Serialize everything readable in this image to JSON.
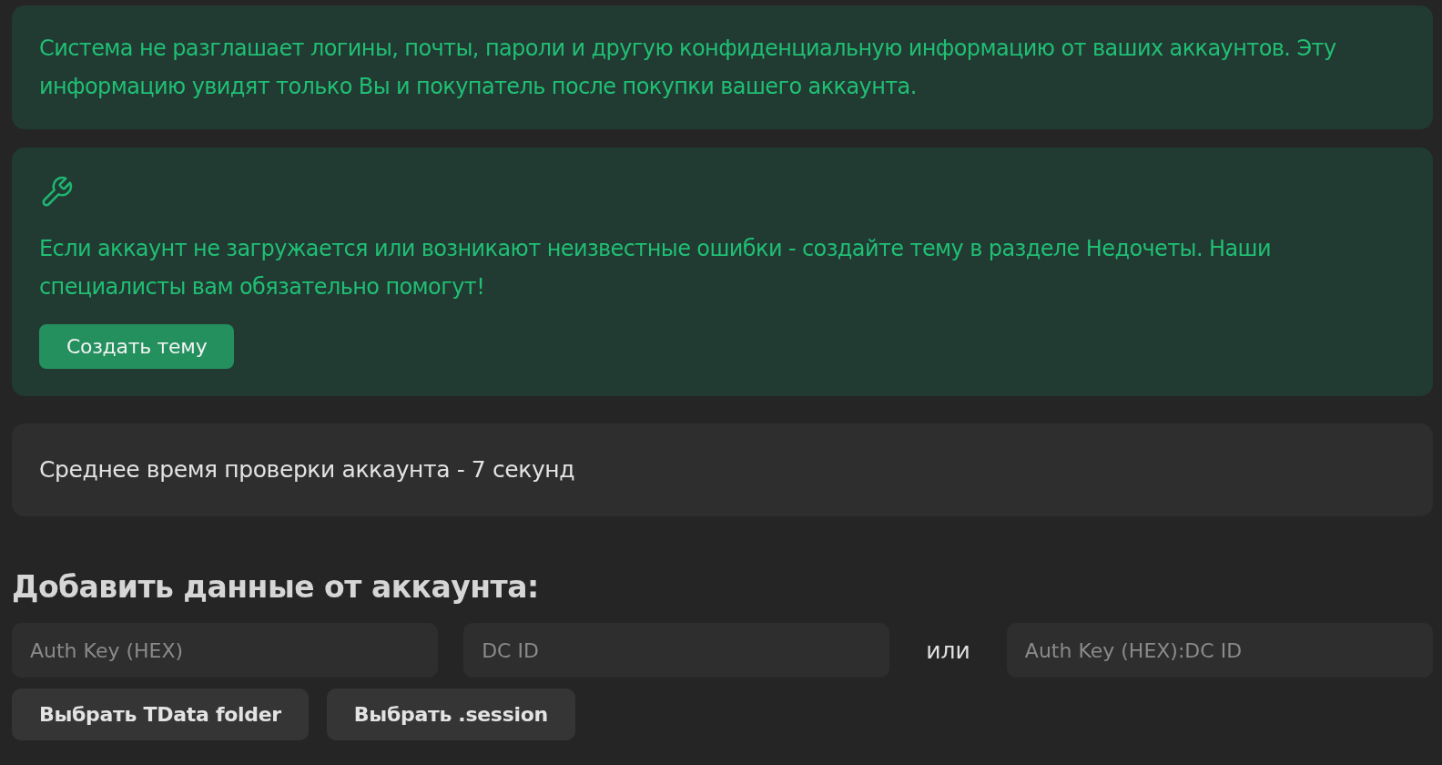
{
  "privacy_notice": {
    "text": "Система не разглашает логины, почты, пароли и другую конфиденциальную информацию от ваших аккаунтов. Эту информацию увидят только Вы и покупатель после покупки вашего аккаунта."
  },
  "support_notice": {
    "text": "Если аккаунт не загружается или возникают неизвестные ошибки - создайте тему в разделе Недочеты. Наши специалисты вам обязательно помогут!",
    "button": "Создать тему"
  },
  "check_time": {
    "text": "Среднее время проверки аккаунта - 7 секунд"
  },
  "add_account": {
    "heading": "Добавить данные от аккаунта:",
    "fields": [
      {
        "placeholder": "Auth Key (HEX)"
      },
      {
        "placeholder": "DC ID"
      }
    ],
    "separator": "или",
    "combined_field": {
      "placeholder": "Auth Key (HEX):DC ID"
    },
    "buttons": [
      "Выбрать TData folder",
      "Выбрать .session"
    ]
  }
}
